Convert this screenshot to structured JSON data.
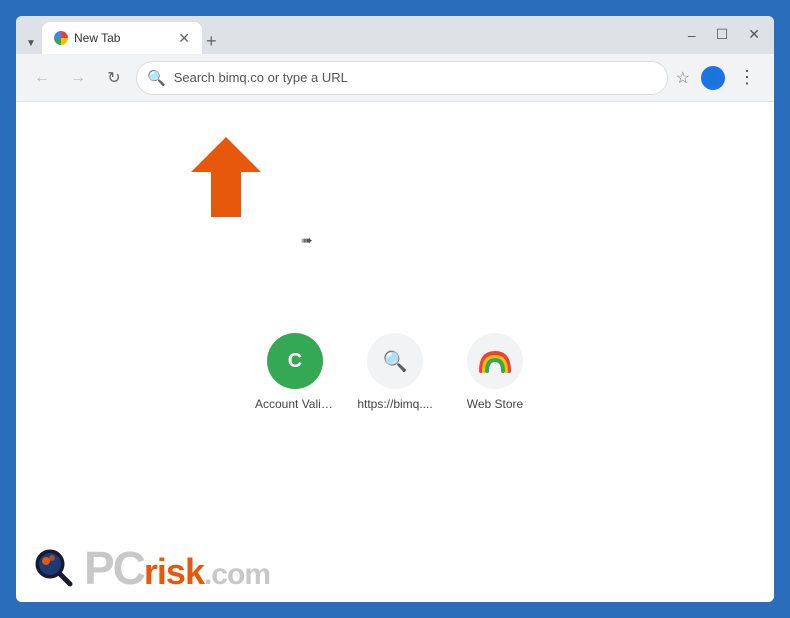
{
  "window": {
    "title": "New Tab",
    "controls": {
      "minimize": "–",
      "maximize": "☐",
      "close": "✕"
    }
  },
  "addressBar": {
    "placeholder": "Search bimq.co or type a URL",
    "backBtn": "←",
    "forwardBtn": "→",
    "reloadBtn": "↻"
  },
  "shortcuts": [
    {
      "id": "account-valid",
      "label": "Account Valid...",
      "iconType": "green-c",
      "iconText": "C"
    },
    {
      "id": "bimq",
      "label": "https://bimq....",
      "iconType": "search",
      "iconText": "🔍"
    },
    {
      "id": "web-store",
      "label": "Web Store",
      "iconType": "rainbow",
      "iconText": ""
    }
  ],
  "watermark": {
    "pc": "PC",
    "risk": "risk",
    "dotcom": ".com"
  }
}
